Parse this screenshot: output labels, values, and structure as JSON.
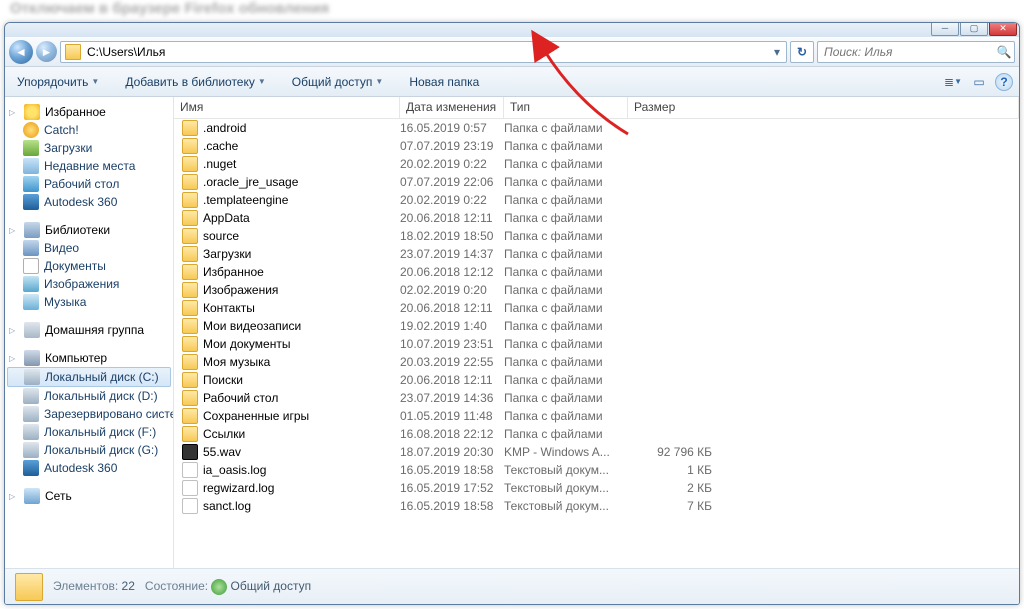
{
  "address_path": "C:\\Users\\Илья",
  "search_placeholder": "Поиск: Илья",
  "toolbar": {
    "organize": "Упорядочить",
    "add_library": "Добавить в библиотеку",
    "share": "Общий доступ",
    "new_folder": "Новая папка"
  },
  "sidebar": {
    "favorites": {
      "header": "Избранное",
      "items": [
        "Catch!",
        "Загрузки",
        "Недавние места",
        "Рабочий стол",
        "Autodesk 360"
      ]
    },
    "libraries": {
      "header": "Библиотеки",
      "items": [
        "Видео",
        "Документы",
        "Изображения",
        "Музыка"
      ]
    },
    "homegroup": {
      "header": "Домашняя группа"
    },
    "computer": {
      "header": "Компьютер",
      "items": [
        "Локальный диск (C:)",
        "Локальный диск (D:)",
        "Зарезервировано систе",
        "Локальный диск (F:)",
        "Локальный диск (G:)",
        "Autodesk 360"
      ]
    },
    "network": {
      "header": "Сеть"
    }
  },
  "columns": {
    "name": "Имя",
    "date": "Дата изменения",
    "type": "Тип",
    "size": "Размер"
  },
  "files": [
    {
      "icon": "ico-folder",
      "name": ".android",
      "date": "16.05.2019 0:57",
      "type": "Папка с файлами",
      "size": ""
    },
    {
      "icon": "ico-folder",
      "name": ".cache",
      "date": "07.07.2019 23:19",
      "type": "Папка с файлами",
      "size": ""
    },
    {
      "icon": "ico-folder",
      "name": ".nuget",
      "date": "20.02.2019 0:22",
      "type": "Папка с файлами",
      "size": ""
    },
    {
      "icon": "ico-folder",
      "name": ".oracle_jre_usage",
      "date": "07.07.2019 22:06",
      "type": "Папка с файлами",
      "size": ""
    },
    {
      "icon": "ico-folder",
      "name": ".templateengine",
      "date": "20.02.2019 0:22",
      "type": "Папка с файлами",
      "size": ""
    },
    {
      "icon": "ico-folder",
      "name": "AppData",
      "date": "20.06.2018 12:11",
      "type": "Папка с файлами",
      "size": ""
    },
    {
      "icon": "ico-folder",
      "name": "source",
      "date": "18.02.2019 18:50",
      "type": "Папка с файлами",
      "size": ""
    },
    {
      "icon": "ico-folder",
      "name": "Загрузки",
      "date": "23.07.2019 14:37",
      "type": "Папка с файлами",
      "size": ""
    },
    {
      "icon": "ico-folder",
      "name": "Избранное",
      "date": "20.06.2018 12:12",
      "type": "Папка с файлами",
      "size": ""
    },
    {
      "icon": "ico-folder",
      "name": "Изображения",
      "date": "02.02.2019 0:20",
      "type": "Папка с файлами",
      "size": ""
    },
    {
      "icon": "ico-folder",
      "name": "Контакты",
      "date": "20.06.2018 12:11",
      "type": "Папка с файлами",
      "size": ""
    },
    {
      "icon": "ico-folder",
      "name": "Мои видеозаписи",
      "date": "19.02.2019 1:40",
      "type": "Папка с файлами",
      "size": ""
    },
    {
      "icon": "ico-folder",
      "name": "Мои документы",
      "date": "10.07.2019 23:51",
      "type": "Папка с файлами",
      "size": ""
    },
    {
      "icon": "ico-folder",
      "name": "Моя музыка",
      "date": "20.03.2019 22:55",
      "type": "Папка с файлами",
      "size": ""
    },
    {
      "icon": "ico-folder",
      "name": "Поиски",
      "date": "20.06.2018 12:11",
      "type": "Папка с файлами",
      "size": ""
    },
    {
      "icon": "ico-folder",
      "name": "Рабочий стол",
      "date": "23.07.2019 14:36",
      "type": "Папка с файлами",
      "size": ""
    },
    {
      "icon": "ico-folder",
      "name": "Сохраненные игры",
      "date": "01.05.2019 11:48",
      "type": "Папка с файлами",
      "size": ""
    },
    {
      "icon": "ico-folder",
      "name": "Ссылки",
      "date": "16.08.2018 22:12",
      "type": "Папка с файлами",
      "size": ""
    },
    {
      "icon": "ico-wav",
      "name": "55.wav",
      "date": "18.07.2019 20:30",
      "type": "KMP - Windows A...",
      "size": "92 796 КБ"
    },
    {
      "icon": "ico-txt",
      "name": "ia_oasis.log",
      "date": "16.05.2019 18:58",
      "type": "Текстовый докум...",
      "size": "1 КБ"
    },
    {
      "icon": "ico-txt",
      "name": "regwizard.log",
      "date": "16.05.2019 17:52",
      "type": "Текстовый докум...",
      "size": "2 КБ"
    },
    {
      "icon": "ico-txt",
      "name": "sanct.log",
      "date": "16.05.2019 18:58",
      "type": "Текстовый докум...",
      "size": "7 КБ"
    }
  ],
  "status": {
    "elements_label": "Элементов:",
    "elements_count": "22",
    "state_label": "Состояние:",
    "state_value": "Общий доступ"
  },
  "sidebar_icons": {
    "favorites": [
      "ico-catch",
      "ico-down",
      "ico-recent",
      "ico-desk",
      "ico-a360"
    ],
    "libraries": [
      "ico-vid",
      "ico-doc",
      "ico-img",
      "ico-mus"
    ],
    "computer": [
      "ico-drv",
      "ico-drv",
      "ico-drv",
      "ico-drv",
      "ico-drv",
      "ico-a360"
    ]
  }
}
